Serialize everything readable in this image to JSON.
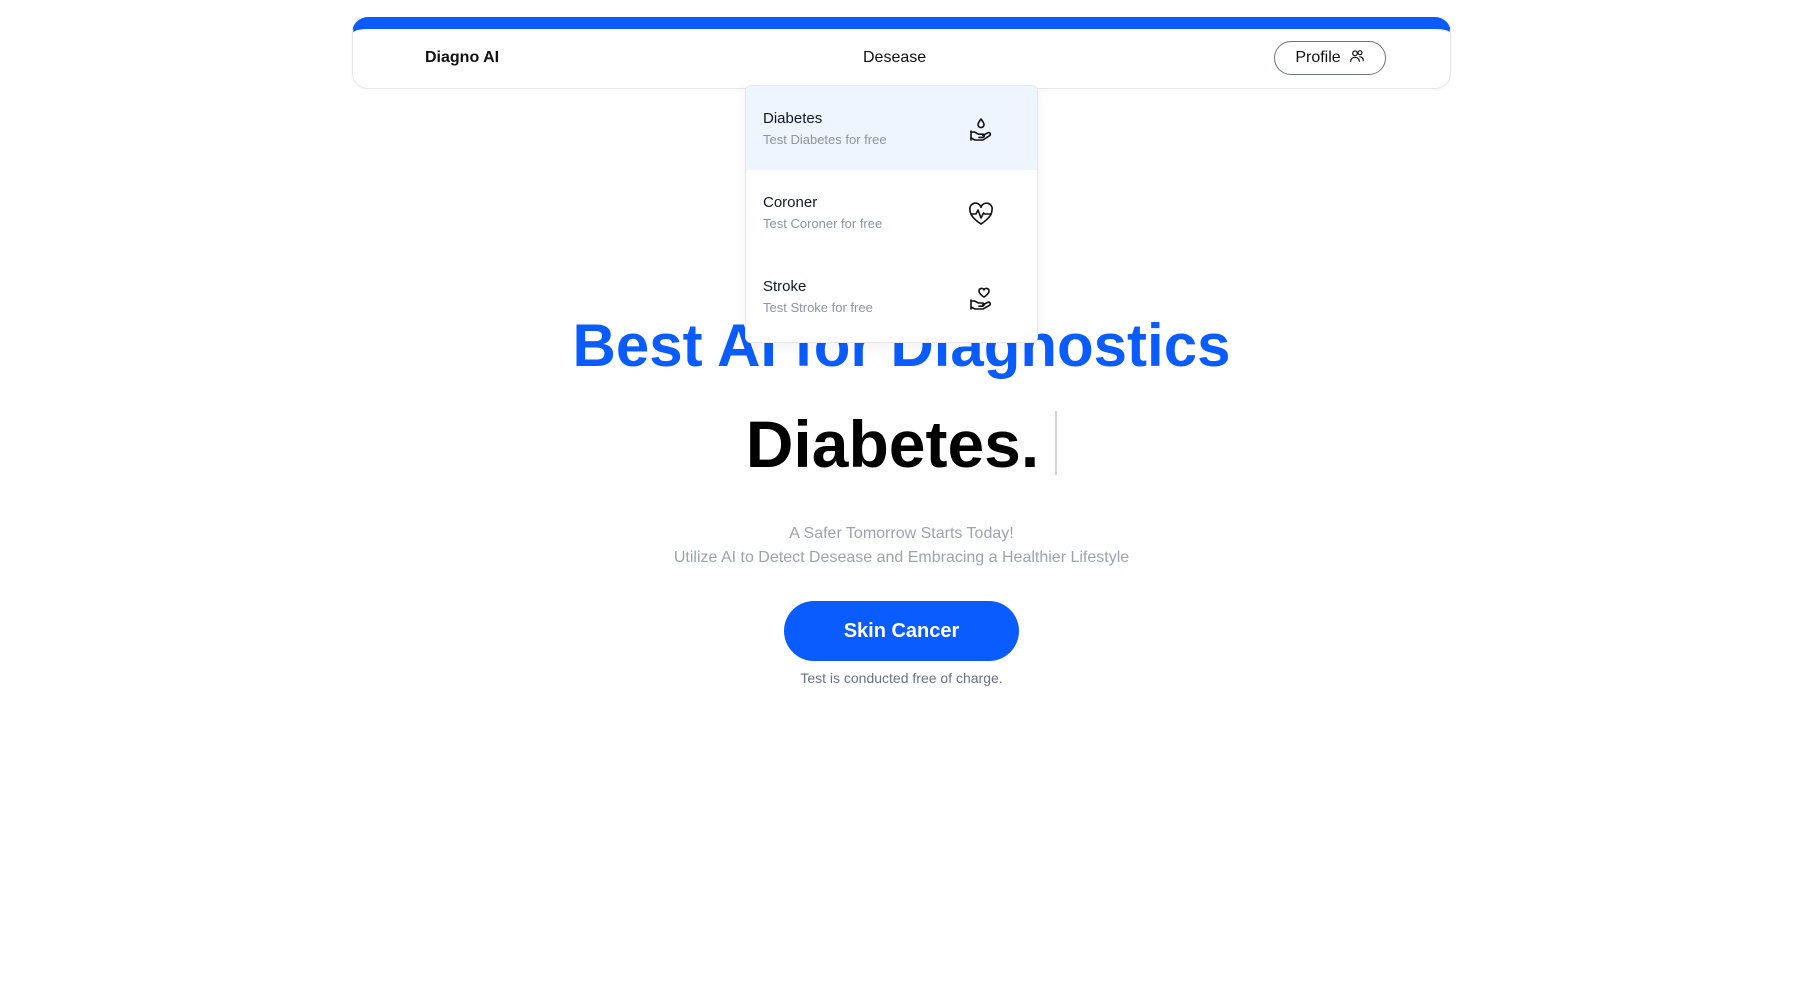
{
  "navbar": {
    "brand": "Diagno AI",
    "nav_link": "Desease",
    "profile_label": "Profile",
    "profile_icon": "users-icon",
    "accent_color": "#0b5cff"
  },
  "dropdown": {
    "items": [
      {
        "title": "Diabetes",
        "subtitle": "Test Diabetes for free",
        "icon": "hand-drop-icon",
        "active": true
      },
      {
        "title": "Coroner",
        "subtitle": "Test Coroner for free",
        "icon": "heart-pulse-icon",
        "active": false
      },
      {
        "title": "Stroke",
        "subtitle": "Test Stroke for free",
        "icon": "hand-heart-icon",
        "active": false
      }
    ]
  },
  "hero": {
    "title": "Best AI for Diagnostics",
    "typed_word": "Diabetes.",
    "tagline_line1": "A Safer Tomorrow Starts Today!",
    "tagline_line2": "Utilize AI to Detect Desease and Embracing a Healthier Lifestyle",
    "cta_label": "Skin Cancer",
    "note": "Test is conducted free of charge."
  }
}
